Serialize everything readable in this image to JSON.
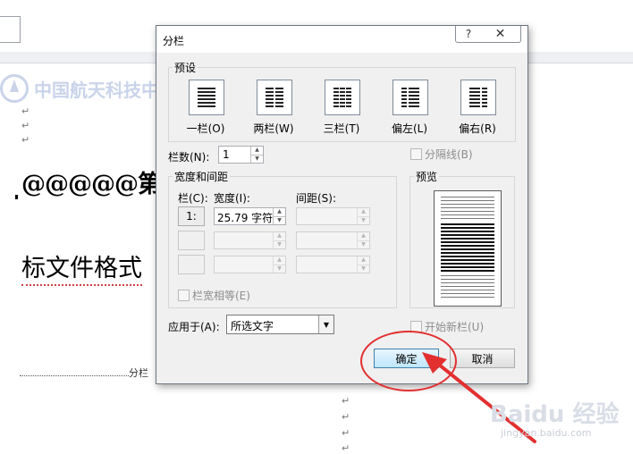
{
  "document": {
    "watermark_text": "中国航天科技中",
    "heading_line1": "@@@@@第",
    "heading_line2": "标文件格式",
    "toc_text": "分栏",
    "para_mark": "↵"
  },
  "dialog": {
    "title": "分栏",
    "help_label": "?",
    "close_label": "✕",
    "presets": {
      "group_label": "预设",
      "items": [
        {
          "label": "一栏(O)",
          "type": "one"
        },
        {
          "label": "两栏(W)",
          "type": "two"
        },
        {
          "label": "三栏(T)",
          "type": "three"
        },
        {
          "label": "偏左(L)",
          "type": "left"
        },
        {
          "label": "偏右(R)",
          "type": "right"
        }
      ]
    },
    "num_columns": {
      "label": "栏数(N):",
      "value": "1"
    },
    "separator_line": {
      "label": "分隔线(B)",
      "checked": false
    },
    "width_spacing": {
      "group_label": "宽度和间距",
      "col_header": "栏(C):",
      "width_header": "宽度(I):",
      "spacing_header": "间距(S):",
      "rows": [
        {
          "col": "1:",
          "width": "25.79 字符",
          "spacing": ""
        },
        {
          "col": "",
          "width": "",
          "spacing": ""
        },
        {
          "col": "",
          "width": "",
          "spacing": ""
        }
      ],
      "equal_width": {
        "label": "栏宽相等(E)",
        "checked": false
      }
    },
    "preview": {
      "group_label": "预览"
    },
    "apply_to": {
      "label": "应用于(A):",
      "value": "所选文字"
    },
    "start_new_column": {
      "label": "开始新栏(U)",
      "checked": false
    },
    "ok_label": "确定",
    "cancel_label": "取消"
  },
  "watermark_brand": {
    "text": "Baidu 经验",
    "sub": "jingyan.baidu.com"
  },
  "colors": {
    "annotation": "#e23030",
    "primary_button_border": "#3c7fb1"
  }
}
